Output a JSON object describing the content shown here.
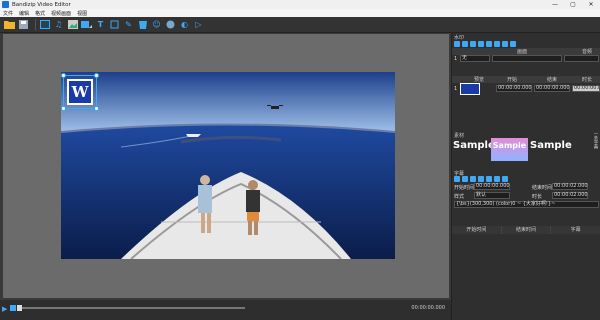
{
  "window": {
    "title": "Bandizip Video Editor",
    "minimize": "—",
    "maximize": "▢",
    "close": "✕"
  },
  "menu": [
    "文件",
    "编辑",
    "格式",
    "视频画面",
    "视图"
  ],
  "toolbar": {
    "icons": [
      "open-folder-icon",
      "save-icon",
      "image-icon",
      "audio-icon",
      "picture-icon",
      "shape-icon",
      "text-icon",
      "crop-icon",
      "effects-icon",
      "cup-icon",
      "emoji-icon",
      "filter-icon",
      "speed-icon",
      "export-icon"
    ]
  },
  "player": {
    "timecode": "00:00:00.000",
    "progress": 0.0,
    "overlay_letter": "W"
  },
  "right_panel": {
    "track_section": {
      "title": "水印",
      "columns": [
        "画面",
        "音频"
      ],
      "track_number": "1",
      "track_mode": "无"
    },
    "timeline_section": {
      "columns": [
        "预览",
        "开始",
        "结束",
        "时长"
      ],
      "row_number": "1",
      "start": "00:00:00.000",
      "end": "00:00:00.000",
      "duration": "00:00:00.000"
    },
    "preview_section": {
      "title": "素材",
      "sample_left": "Sample",
      "sample_center": "Sample",
      "sample_right": "Sample",
      "vertical_label": "一条字幕"
    },
    "subtitle_section": {
      "title": "字幕",
      "start_label": "开始时间",
      "start_value": "00:00:00.000",
      "end_label": "结束时间",
      "end_value": "00:00:02.000",
      "style_label": "样式",
      "style_value": "默认",
      "duration_label": "时长",
      "duration_value": "00:00:02.000",
      "content": "{\\bs}(300,300) (color)0 ~ {大家好啊!}~"
    },
    "tabs": [
      "开始时间",
      "结束时间",
      "字幕"
    ]
  }
}
